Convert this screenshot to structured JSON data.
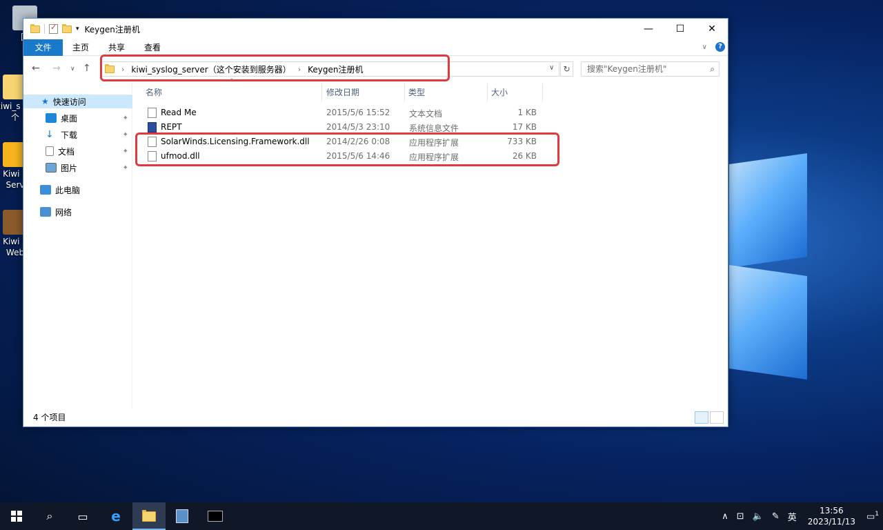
{
  "window": {
    "title": "Keygen注册机",
    "controls": {
      "minimize": "—",
      "maximize": "☐",
      "close": "✕"
    }
  },
  "ribbon": {
    "tabs": [
      "文件",
      "主页",
      "共享",
      "查看"
    ],
    "help": "?"
  },
  "address": {
    "crumbs": [
      "kiwi_syslog_server（这个安装到服务器）",
      "Keygen注册机"
    ],
    "search_placeholder": "搜索\"Keygen注册机\""
  },
  "nav": {
    "quick_access": "快速访问",
    "items": [
      "桌面",
      "下载",
      "文档",
      "图片"
    ],
    "this_pc": "此电脑",
    "network": "网络"
  },
  "columns": {
    "name": "名称",
    "date": "修改日期",
    "type": "类型",
    "size": "大小"
  },
  "files": [
    {
      "name": "Read Me",
      "date": "2015/5/6 15:52",
      "type": "文本文档",
      "size": "1 KB"
    },
    {
      "name": "REPT",
      "date": "2014/5/3 23:10",
      "type": "系统信息文件",
      "size": "17 KB"
    },
    {
      "name": "SolarWinds.Licensing.Framework.dll",
      "date": "2014/2/26 0:08",
      "type": "应用程序扩展",
      "size": "733 KB"
    },
    {
      "name": "ufmod.dll",
      "date": "2015/5/6 14:46",
      "type": "应用程序扩展",
      "size": "26 KB"
    }
  ],
  "status": {
    "count": "4 个项目"
  },
  "desktop": {
    "icons": [
      {
        "label": "回"
      },
      {
        "label": "kiwi_s (这个"
      },
      {
        "label": "Kiwi S Serv"
      },
      {
        "label": "Kiwi S Web"
      }
    ]
  },
  "taskbar": {
    "ime": "英",
    "time": "13:56",
    "date": "2023/11/13",
    "notification_count": "1"
  }
}
